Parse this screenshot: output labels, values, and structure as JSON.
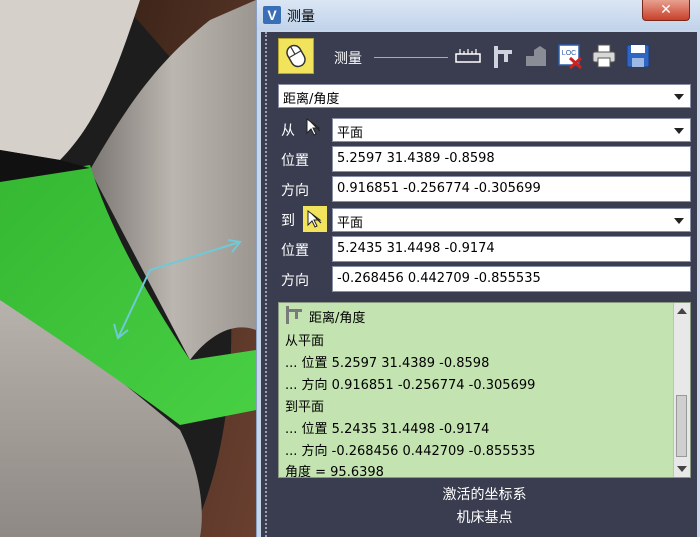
{
  "window": {
    "title": "测量",
    "app_icon": "V",
    "close_glyph": "✕"
  },
  "toolbar": {
    "label": "测量",
    "icons": [
      "mouse-icon",
      "ruler-icon",
      "caliper-icon",
      "part-icon",
      "loc-delete-icon",
      "printer-icon",
      "save-icon"
    ],
    "loc_text": "LOC"
  },
  "mode_select": "距离/角度",
  "from": {
    "label": "从",
    "type": "平面",
    "position_label": "位置",
    "position": "5.2597 31.4389 -0.8598",
    "direction_label": "方向",
    "direction": "0.916851 -0.256774 -0.305699"
  },
  "to": {
    "label": "到",
    "type": "平面",
    "position_label": "位置",
    "position": "5.2435 31.4498 -0.9174",
    "direction_label": "方向",
    "direction": "-0.268456 0.442709 -0.855535"
  },
  "output": {
    "heading": "距离/角度",
    "lines": [
      "从平面",
      "... 位置 5.2597 31.4389 -0.8598",
      "... 方向 0.916851 -0.256774 -0.305699",
      "到平面",
      "... 位置 5.2435 31.4498 -0.9174",
      "... 方向 -0.268456 0.442709 -0.855535",
      "角度 = 95.6398"
    ]
  },
  "status": {
    "line1": "激活的坐标系",
    "line2": "机床基点"
  },
  "colors": {
    "panel_bg": "#3a3d50",
    "highlight_yellow": "#f2e35c",
    "output_bg": "#c3e3b1",
    "green_surface": "#3cc33a",
    "arrow_cyan": "#6fc9d6"
  }
}
